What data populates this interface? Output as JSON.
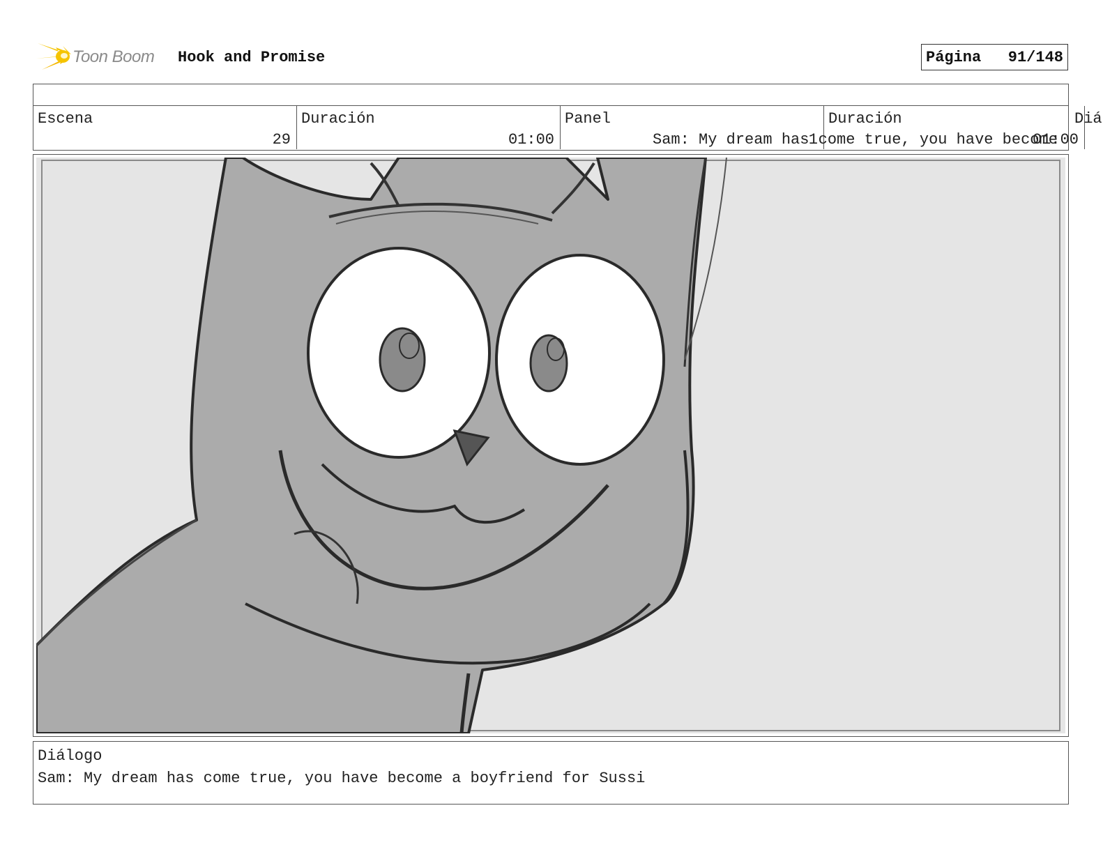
{
  "header": {
    "logo_text": "Toon Boom",
    "project_title": "Hook and Promise",
    "page_label": "Página",
    "page_number": "91/148"
  },
  "info": {
    "scene_label": "Escena",
    "scene_value": "29",
    "scene_duration_label": "Duración",
    "scene_duration_value": "01:00",
    "panel_label": "Panel",
    "panel_value": "1",
    "panel_duration_label": "Duración",
    "panel_duration_value": "01:00",
    "dialog_label_truncated": "Diá",
    "dialog_overflow": "Sam: My dream has come true, you have become"
  },
  "panel": {
    "image_icon": "storyboard-sketch-cat-character",
    "colors": {
      "background": "#e5e5e5",
      "character_fill": "#aaaaaa",
      "eyes": "#ffffff"
    }
  },
  "dialogue": {
    "label": "Diálogo",
    "text": "Sam: My dream has come true, you have become a boyfriend for Sussi"
  },
  "colors": {
    "logo_flare": "#f5c400",
    "border": "#555555"
  }
}
